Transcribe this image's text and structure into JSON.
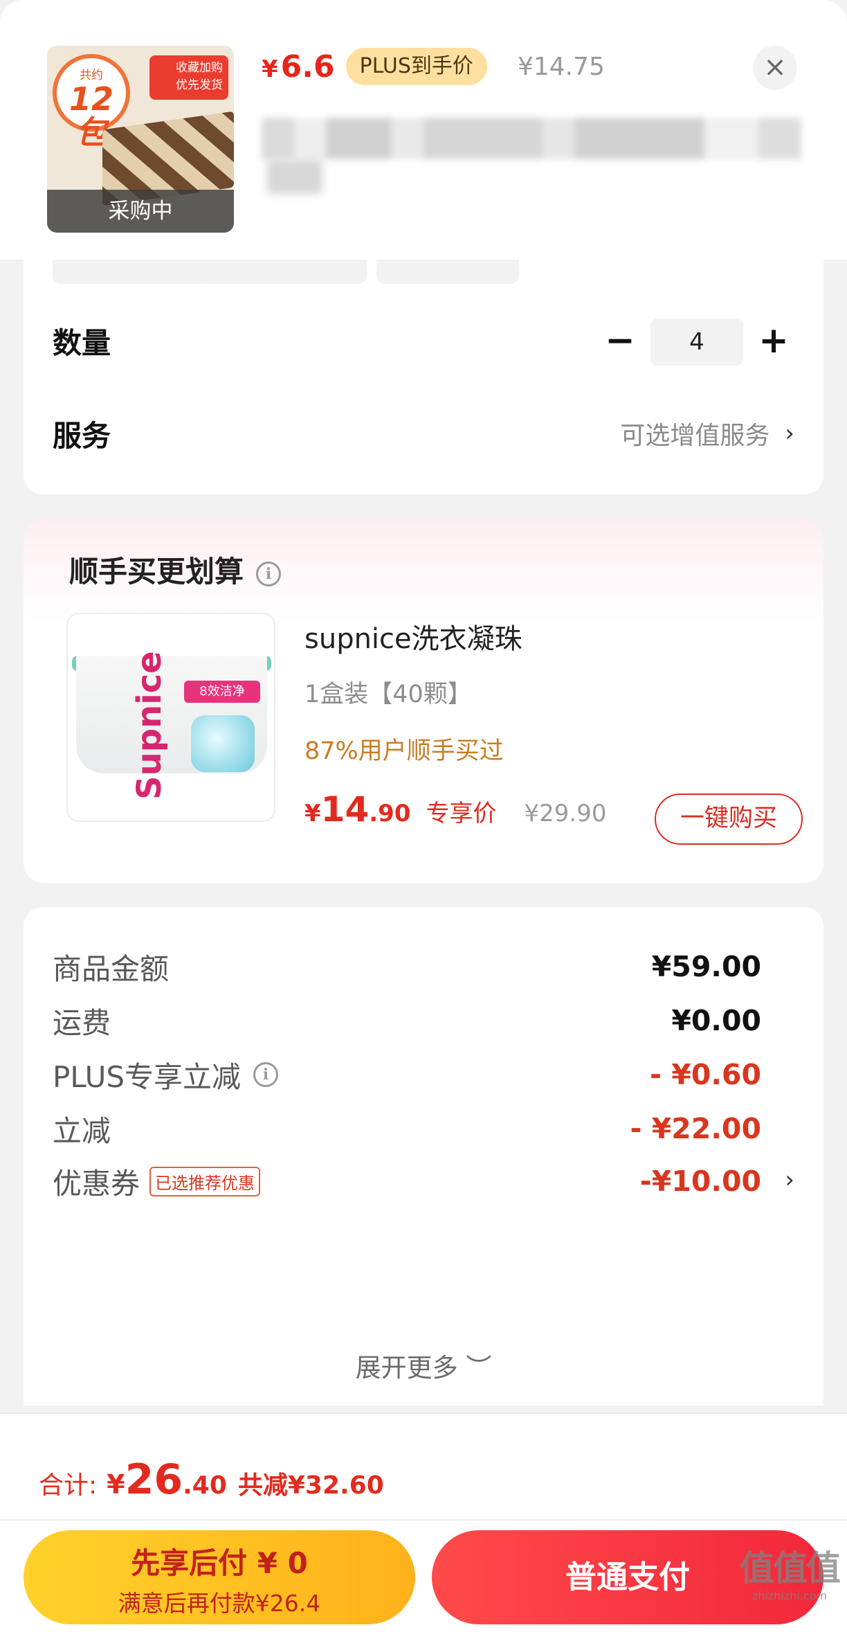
{
  "product": {
    "thumb_badge_small": "共约",
    "thumb_badge_big": "12包",
    "thumb_promo": "收藏加购\n优先发货",
    "status": "采购中",
    "currency": "¥",
    "price": "6.6",
    "plus_tag": "PLUS到手价",
    "original_price": "¥14.75",
    "close_icon": "×"
  },
  "options": {
    "quantity_label": "数量",
    "quantity_value": "4",
    "minus": "−",
    "plus": "+",
    "service_label": "服务",
    "service_link": "可选增值服务",
    "chevron": "›"
  },
  "addon": {
    "title": "顺手买更划算",
    "info_icon": "i",
    "image_logo": "Supnice",
    "image_tag": "8效洁净",
    "name": "supnice洗衣凝珠",
    "spec": "1盒装【40颗】",
    "popularity": "87%用户顺手买过",
    "price_currency": "¥",
    "price_int": "14",
    "price_dec": ".90",
    "price_tag": "专享价",
    "original_price": "¥29.90",
    "buy_button": "一键购买"
  },
  "breakdown": {
    "items": [
      {
        "label": "商品金额",
        "value": "¥59.00"
      },
      {
        "label": "运费",
        "value": "¥0.00"
      },
      {
        "label": "PLUS专享立减",
        "value": "- ¥0.60"
      },
      {
        "label": "立减",
        "value": "- ¥22.00"
      },
      {
        "label": "优惠券",
        "value": "-¥10.00"
      }
    ],
    "coupon_tag": "已选推荐优惠",
    "expand": "展开更多 ︶"
  },
  "footer": {
    "total_label": "合计:",
    "total_currency": "¥",
    "total_int": "26",
    "total_dec": ".40",
    "total_saved": "共减¥32.60",
    "later_title": "先享后付 ¥ 0",
    "later_sub": "满意后再付款¥26.4",
    "pay_button": "普通支付"
  },
  "watermark": {
    "logo": "值值值",
    "url": "zhizhizhi.com"
  },
  "colors": {
    "accent_red": "#e22a1e",
    "plus_gold": "#fde0a0",
    "later_yellow": "#ffc21f",
    "pay_red": "#f2283b",
    "popularity_orange": "#c97d23"
  }
}
